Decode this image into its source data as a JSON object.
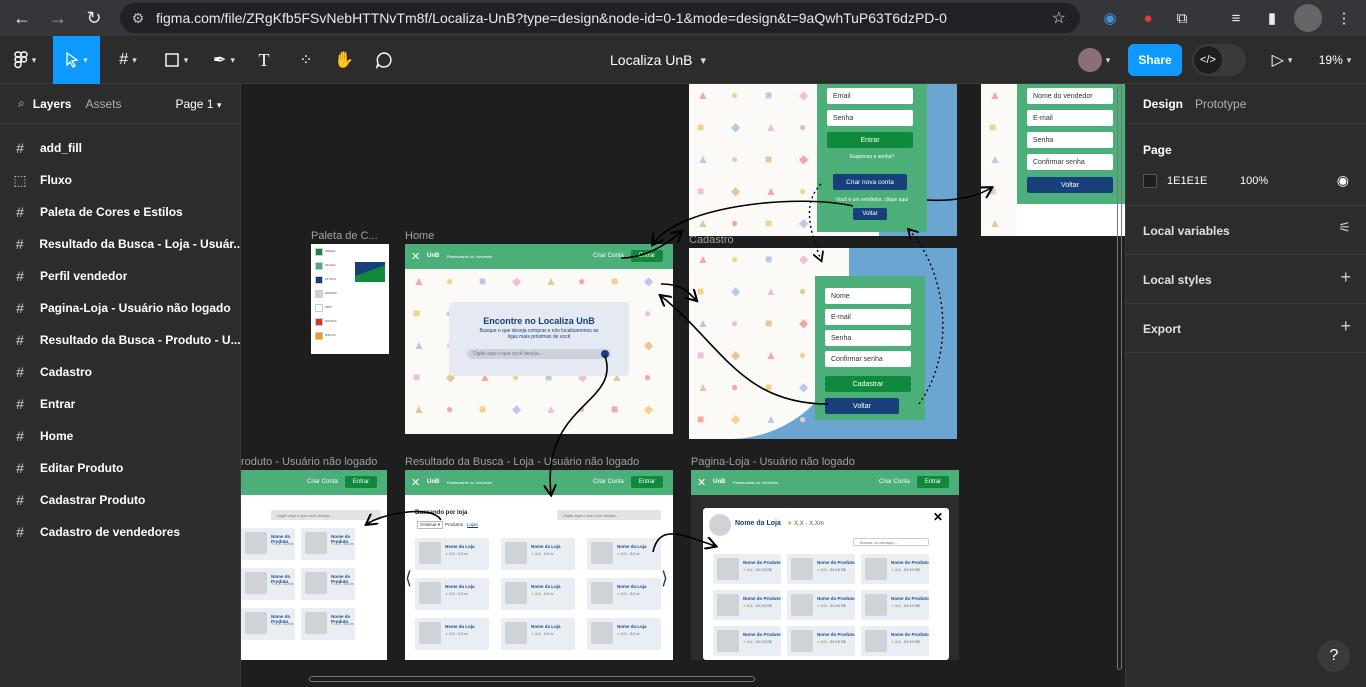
{
  "browser": {
    "url": "figma.com/file/ZRgKfb5FSvNebHTTNvTm8f/Localiza-UnB?type=design&node-id=0-1&mode=design&t=9aQwhTuP63T6dzPD-0"
  },
  "toolbar": {
    "file_name": "Localiza UnB",
    "share_label": "Share",
    "zoom": "19%"
  },
  "left_panel": {
    "tab_layers": "Layers",
    "tab_assets": "Assets",
    "page": "Page 1",
    "layers": [
      {
        "icon": "frame-icon",
        "label": "add_fill"
      },
      {
        "icon": "section-icon",
        "label": "Fluxo"
      },
      {
        "icon": "frame-icon",
        "label": "Paleta de Cores e Estilos"
      },
      {
        "icon": "frame-icon",
        "label": "Resultado da Busca - Loja - Usuár..."
      },
      {
        "icon": "frame-icon",
        "label": "Perfil vendedor"
      },
      {
        "icon": "frame-icon",
        "label": "Pagina-Loja - Usuário não logado"
      },
      {
        "icon": "frame-icon",
        "label": "Resultado da Busca - Produto - U..."
      },
      {
        "icon": "frame-icon",
        "label": "Cadastro"
      },
      {
        "icon": "frame-icon",
        "label": "Entrar"
      },
      {
        "icon": "frame-icon",
        "label": "Home"
      },
      {
        "icon": "frame-icon",
        "label": "Editar Produto"
      },
      {
        "icon": "frame-icon",
        "label": "Cadastrar Produto"
      },
      {
        "icon": "frame-icon",
        "label": "Cadastro de vendedores"
      }
    ]
  },
  "right_panel": {
    "tab_design": "Design",
    "tab_prototype": "Prototype",
    "page_heading": "Page",
    "page_color": "1E1E1E",
    "page_opacity": "100%",
    "local_variables": "Local variables",
    "local_styles": "Local styles",
    "export": "Export"
  },
  "canvas": {
    "labels": {
      "paleta": "Paleta de C...",
      "home": "Home",
      "cadastro": "Cadastro",
      "produto": "roduto - Usuário não logado",
      "busca_loja": "Resultado da Busca - Loja - Usuário não logado",
      "pagina_loja": "Pagina-Loja - Usuário não logado"
    },
    "home": {
      "brand": "UnB",
      "header_text": "Restaurante ou Vendedor",
      "criar_conta": "Criar Conta",
      "entrar": "Entrar",
      "hero_title": "Encontre no Localiza UnB",
      "hero_text": "Busque o que deseja comprar e nós localizaremos as lojas mais próximas de você",
      "search_placeholder": "Digite aqui o que você deseja..."
    },
    "entrar": {
      "email": "Email",
      "senha": "Senha",
      "entrar_btn": "Entrar",
      "esqueceu": "Esqueceu a senha?",
      "criar_nova": "Criar nova conta",
      "vendedor": "Você é um vendedor, clique aqui",
      "voltar": "Voltar"
    },
    "vendedor_login": {
      "nome": "Nome do vendedor",
      "email": "E-mail",
      "senha": "Senha",
      "confirmar": "Confirmar senha",
      "voltar": "Voltar"
    },
    "cadastro": {
      "nome": "Nome",
      "email": "E-mail",
      "senha": "Senha",
      "confirmar": "Confirmar senha",
      "cadastrar": "Cadastrar",
      "voltar": "Voltar"
    },
    "busca_loja": {
      "buscando": "Buscando por loja",
      "ordenar": "Ordenar ▾",
      "tab_produtos": "Produtos",
      "tab_lojas": "Lojas",
      "card_title": "Nome da Loja",
      "card_rating": "X,X - X,X m",
      "search_placeholder": "Digite aqui o que você deseja..."
    },
    "produto": {
      "card_title": "Nome do Produto",
      "card_sub": "X,X - X,X m"
    },
    "pagina_loja": {
      "loja_name": "Nome da Loja",
      "loja_rating": "X,X - X,Xm",
      "buscar": "Buscar no cardápio...",
      "card_title": "Nome do Produto",
      "card_sub": "X,X - XX,XX R$"
    },
    "palette": {
      "swatches": [
        {
          "color": "#0f8a3c",
          "label": "#0f8a3c"
        },
        {
          "color": "#4caf7a",
          "label": "#4caf7a"
        },
        {
          "color": "#173f7a",
          "label": "#173f7a"
        },
        {
          "color": "#d0d0d0",
          "label": "#d0d0d0"
        },
        {
          "color": "#ffffff",
          "label": "#ffffff"
        },
        {
          "color": "#d9342b",
          "label": "#d9342b"
        },
        {
          "color": "#f39c12",
          "label": "#f39c12"
        }
      ]
    }
  }
}
